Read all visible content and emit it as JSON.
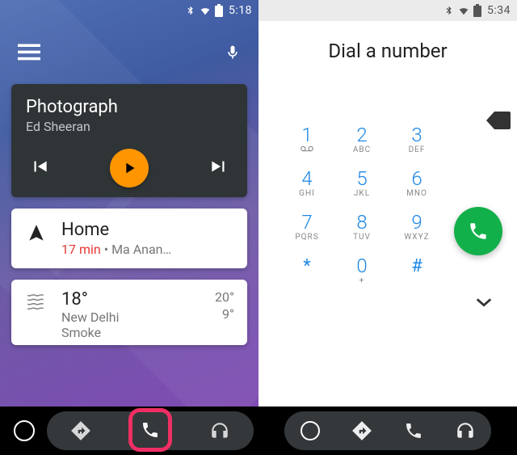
{
  "left": {
    "status": {
      "time": "5:18"
    },
    "media": {
      "title": "Photograph",
      "artist": "Ed Sheeran"
    },
    "nav": {
      "destination": "Home",
      "eta": "17 min",
      "separator": " • ",
      "address": "Ma Anan…"
    },
    "weather": {
      "temp": "18°",
      "location": "New Delhi",
      "condition": "Smoke",
      "high": "20°",
      "low": "9°"
    }
  },
  "right": {
    "status": {
      "time": "5:34"
    },
    "title": "Dial a number",
    "keys": {
      "k1": {
        "d": "1",
        "s": ""
      },
      "k2": {
        "d": "2",
        "s": "ABC"
      },
      "k3": {
        "d": "3",
        "s": "DEF"
      },
      "k4": {
        "d": "4",
        "s": "GHI"
      },
      "k5": {
        "d": "5",
        "s": "JKL"
      },
      "k6": {
        "d": "6",
        "s": "MNO"
      },
      "k7": {
        "d": "7",
        "s": "PQRS"
      },
      "k8": {
        "d": "8",
        "s": "TUV"
      },
      "k9": {
        "d": "9",
        "s": "WXYZ"
      },
      "ks": {
        "d": "*"
      },
      "k0": {
        "d": "0",
        "s": "+"
      },
      "kh": {
        "d": "#"
      }
    }
  }
}
